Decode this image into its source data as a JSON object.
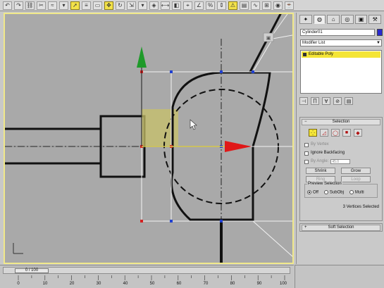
{
  "toolbar": {
    "icons": [
      "undo-icon",
      "redo-icon",
      "link-icon",
      "unlink-icon",
      "bind-icon",
      "select-filter-icon",
      "select-icon",
      "select-by-name-icon",
      "region-icon",
      "move-icon",
      "rotate-icon",
      "scale-icon",
      "coord-icon",
      "pivot-icon",
      "mirror-icon",
      "align-icon",
      "snap-icon",
      "angle-snap-icon",
      "percent-snap-icon",
      "spinner-snap-icon",
      "named-sel-icon",
      "layer-icon",
      "curve-editor-icon",
      "schematic-icon",
      "material-icon",
      "render-icon"
    ]
  },
  "command_panel": {
    "tabs": [
      "✦",
      "◍",
      "⌂",
      "◎",
      "▣",
      "⚒"
    ],
    "object_name": "Cylinder01",
    "object_color": "#2a2ad0",
    "modifier_list": "Modifier List",
    "stack_item": "Editable Poly",
    "selection": {
      "title": "Selection",
      "by_vertex": "By Vertex",
      "ignore_backfacing": "Ignore Backfacing",
      "by_angle": "By Angle:",
      "by_angle_value": "45.0",
      "shrink": "Shrink",
      "grow": "Grow",
      "ring": "Ring",
      "loop": "Loop",
      "preview_selection": "Preview Selection",
      "preview_off": "Off",
      "preview_subobj": "SubObj",
      "preview_multi": "Multi",
      "status": "3 Vertices Selected"
    },
    "soft_selection": "Soft Selection"
  },
  "timeline": {
    "frame_label": "0 / 100",
    "ticks": [
      "0",
      "10",
      "20",
      "30",
      "40",
      "50",
      "60",
      "70",
      "80",
      "90",
      "100"
    ]
  }
}
